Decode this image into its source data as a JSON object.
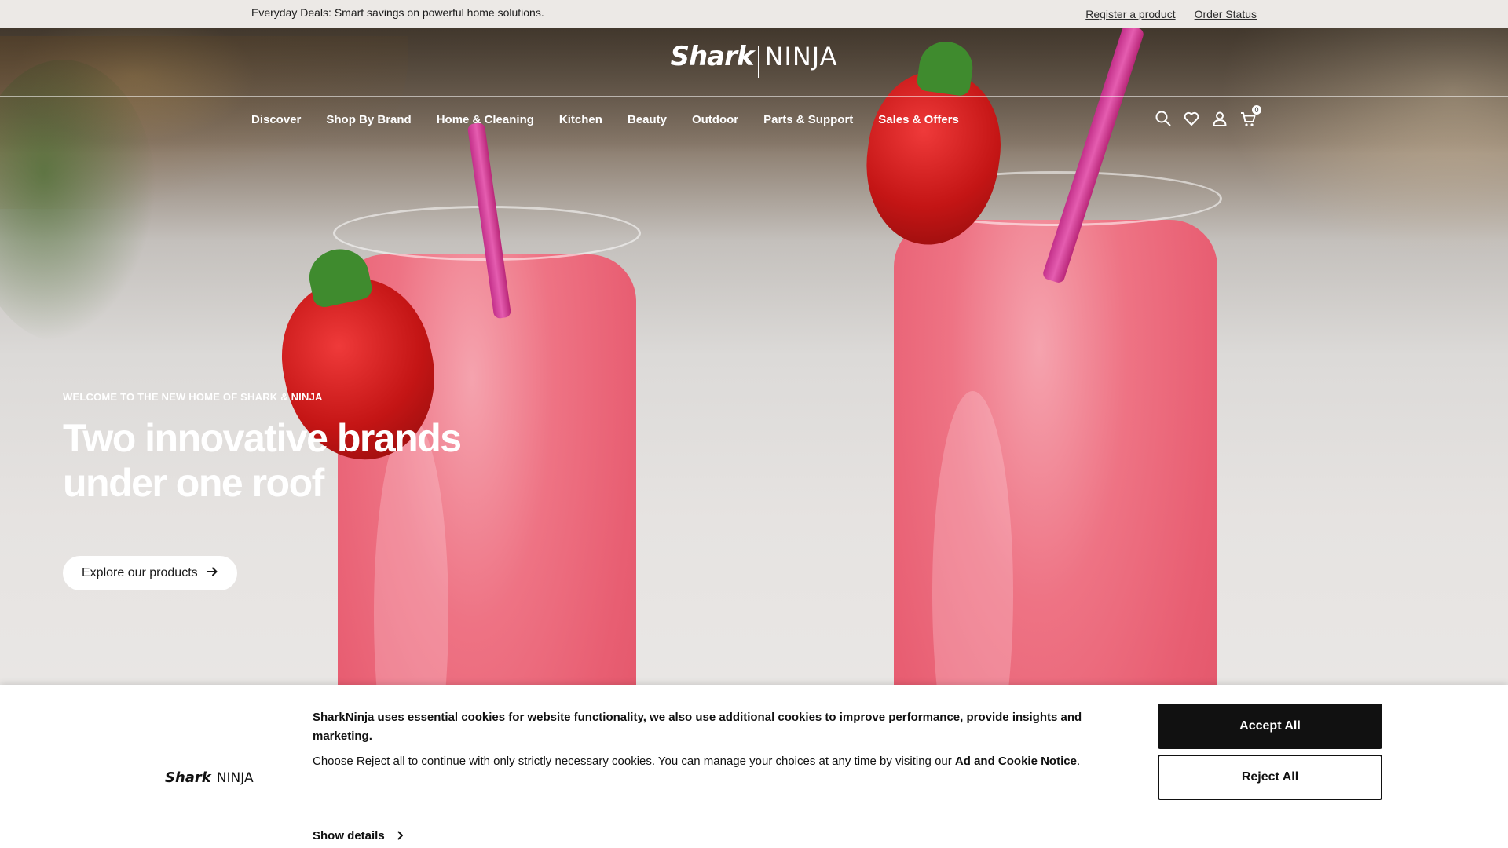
{
  "topbar": {
    "deal_text": "Everyday Deals: Smart savings on powerful home solutions.",
    "links": [
      "Register a product",
      "Order Status"
    ]
  },
  "header": {
    "logo": {
      "brand1": "Shark",
      "brand2": "NINJA"
    },
    "nav": [
      "Discover",
      "Shop By Brand",
      "Home & Cleaning",
      "Kitchen",
      "Beauty",
      "Outdoor",
      "Parts & Support",
      "Sales & Offers"
    ],
    "icons": [
      "search-icon",
      "heart-icon",
      "user-icon",
      "cart-icon"
    ],
    "cart_count": "0"
  },
  "hero": {
    "eyebrow": "WELCOME TO THE NEW HOME OF SHARK & NINJA",
    "headline_line1": "Two innovative brands",
    "headline_line2": "under one roof",
    "cta_label": "Explore our products",
    "cta_icon": "arrow-right-icon"
  },
  "cookie": {
    "logo": {
      "brand1": "Shark",
      "brand2": "NINJA"
    },
    "message_bold": "SharkNinja uses essential cookies for website functionality, we also use additional cookies to improve performance, provide insights and marketing.",
    "message_text": "Choose Reject all to continue with only strictly necessary cookies.  You can manage your choices at any time by visiting our ",
    "notice_link": "Ad and Cookie Notice",
    "message_end": ".",
    "show_details": "Show details",
    "accept_label": "Accept All",
    "reject_label": "Reject All"
  },
  "colors": {
    "accent": "#111111",
    "topbar_bg": "#ece9e6",
    "drink": "#ee7384"
  }
}
